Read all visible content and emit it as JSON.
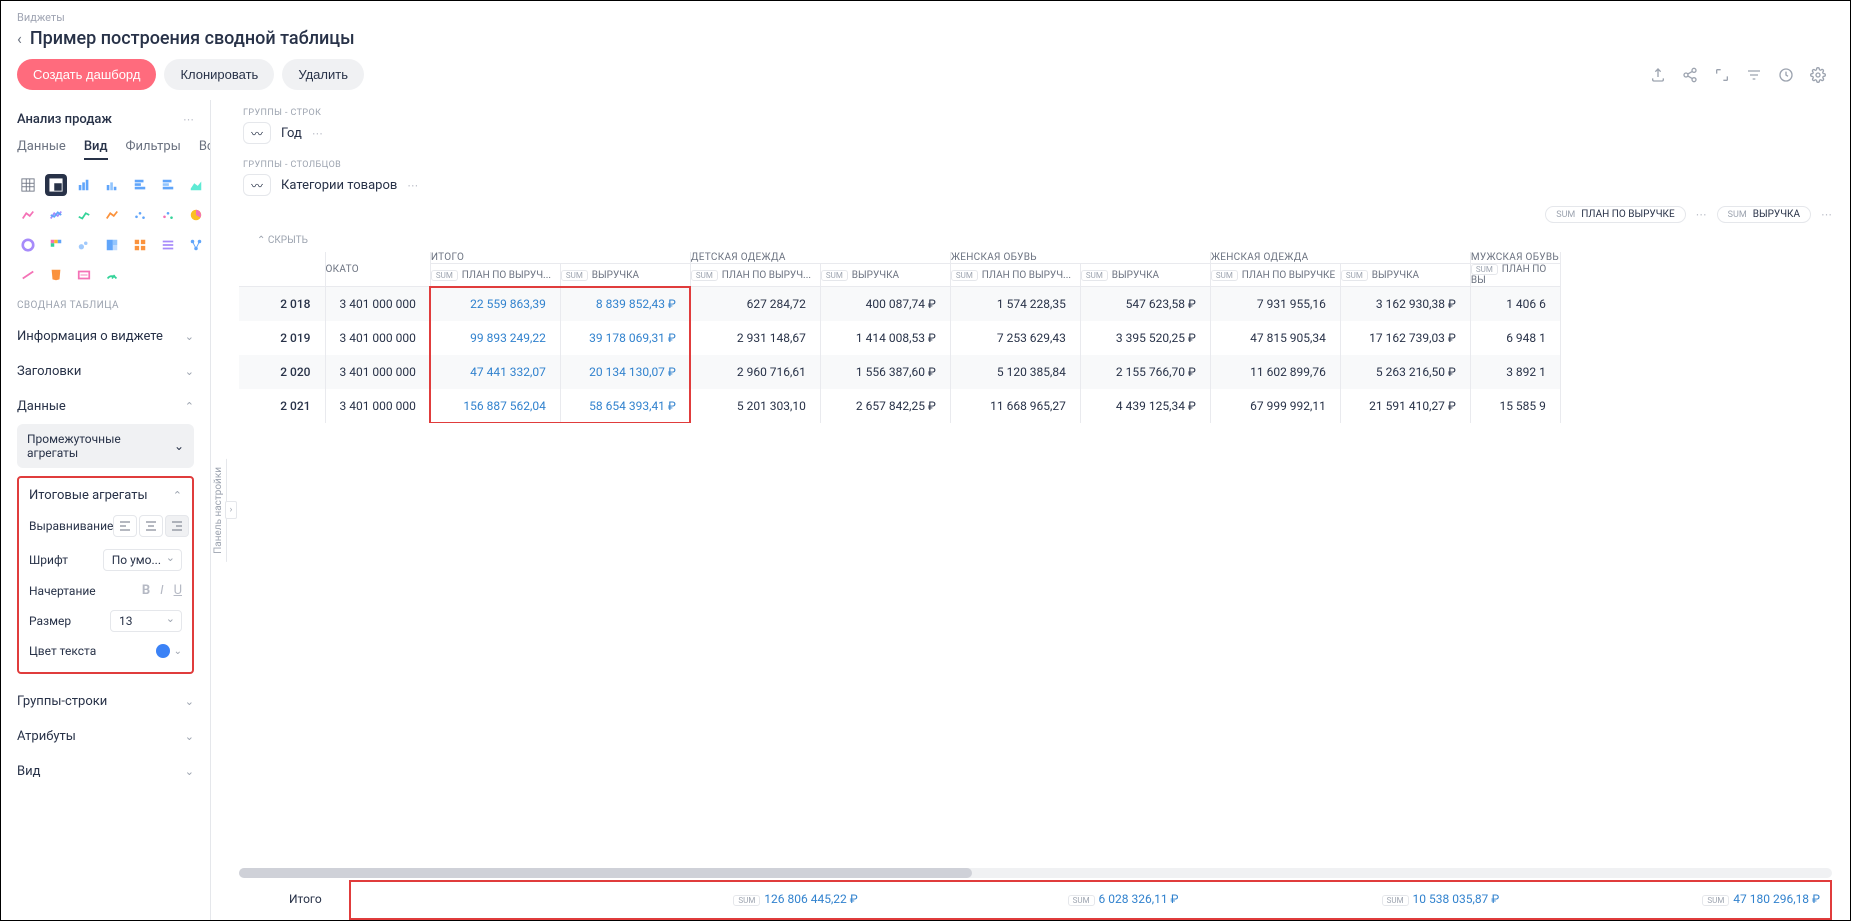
{
  "breadcrumb": "Виджеты",
  "page_title": "Пример построения сводной таблицы",
  "actions": {
    "create": "Создать дашборд",
    "clone": "Клонировать",
    "delete": "Удалить"
  },
  "sidebar": {
    "title": "Анализ продаж",
    "tabs": [
      "Данные",
      "Вид",
      "Фильтры",
      "Все"
    ],
    "active_tab": "Вид",
    "section_label": "СВОДНАЯ ТАБЛИЦА",
    "collapsers": {
      "widget_info": "Информация о виджете",
      "headers": "Заголовки",
      "data": "Данные",
      "group_rows": "Группы-строки",
      "attributes": "Атрибуты",
      "vid": "Вид"
    },
    "sub_pill": "Промежуточные агрегаты",
    "hl_section": {
      "title": "Итоговые агрегаты",
      "align_label": "Выравнивание",
      "font_label": "Шрифт",
      "font_value": "По умо...",
      "weight_label": "Начертание",
      "size_label": "Размер",
      "size_value": "13",
      "color_label": "Цвет текста",
      "text_color": "#3b82f6"
    },
    "vertical_tab": "Панель настройки"
  },
  "groups": {
    "rows_label": "ГРУППЫ - СТРОК",
    "rows_value": "Год",
    "cols_label": "ГРУППЫ - СТОЛБЦОВ",
    "cols_value": "Категории товаров"
  },
  "metrics": {
    "plan": "ПЛАН ПО ВЫРУЧКЕ",
    "revenue": "ВЫРУЧКА",
    "sum": "SUM"
  },
  "hide_label": "СКРЫТЬ",
  "table": {
    "col_okato": "ОКАТО",
    "col_itogo": "ИТОГО",
    "col_kids": "ДЕТСКАЯ ОДЕЖДА",
    "col_wshoes": "ЖЕНСКАЯ ОБУВЬ",
    "col_wclothes": "ЖЕНСКАЯ ОДЕЖДА",
    "col_mshoes": "МУЖСКАЯ ОБУВЬ",
    "sub_plan": "ПЛАН ПО ВЫРУЧ...",
    "sub_plan_full": "ПЛАН ПО ВЫРУЧКЕ",
    "sub_rev": "ВЫРУЧКА",
    "sub_plan_trunc": "ПЛАН ПО ВЫ",
    "rows": [
      {
        "year": "2 018",
        "okato": "3 401 000 000",
        "itogo_p": "22 559 863,39",
        "itogo_r": "8 839 852,43 ₽",
        "kids_p": "627 284,72",
        "kids_r": "400 087,74 ₽",
        "ws_p": "1 574 228,35",
        "ws_r": "547 623,58 ₽",
        "wc_p": "7 931 955,16",
        "wc_r": "3 162 930,38 ₽",
        "ms_p": "1 406 6"
      },
      {
        "year": "2 019",
        "okato": "3 401 000 000",
        "itogo_p": "99 893 249,22",
        "itogo_r": "39 178 069,31 ₽",
        "kids_p": "2 931 148,67",
        "kids_r": "1 414 008,53 ₽",
        "ws_p": "7 253 629,43",
        "ws_r": "3 395 520,25 ₽",
        "wc_p": "47 815 905,34",
        "wc_r": "17 162 739,03 ₽",
        "ms_p": "6 948 1"
      },
      {
        "year": "2 020",
        "okato": "3 401 000 000",
        "itogo_p": "47 441 332,07",
        "itogo_r": "20 134 130,07 ₽",
        "kids_p": "2 960 716,61",
        "kids_r": "1 556 387,60 ₽",
        "ws_p": "5 120 385,84",
        "ws_r": "2 155 766,70 ₽",
        "wc_p": "11 602 899,76",
        "wc_r": "5 263 216,50 ₽",
        "ms_p": "3 892 1"
      },
      {
        "year": "2 021",
        "okato": "3 401 000 000",
        "itogo_p": "156 887 562,04",
        "itogo_r": "58 654 393,41 ₽",
        "kids_p": "5 201 303,10",
        "kids_r": "2 657 842,25 ₽",
        "ws_p": "11 668 965,27",
        "ws_r": "4 439 125,34 ₽",
        "wc_p": "67 999 992,11",
        "wc_r": "21 591 410,27 ₽",
        "ms_p": "15 585 9"
      }
    ]
  },
  "totals": {
    "label": "Итого",
    "cells": [
      "126 806 445,22 ₽",
      "6 028 326,11 ₽",
      "10 538 035,87 ₽",
      "47 180 296,18 ₽"
    ]
  }
}
